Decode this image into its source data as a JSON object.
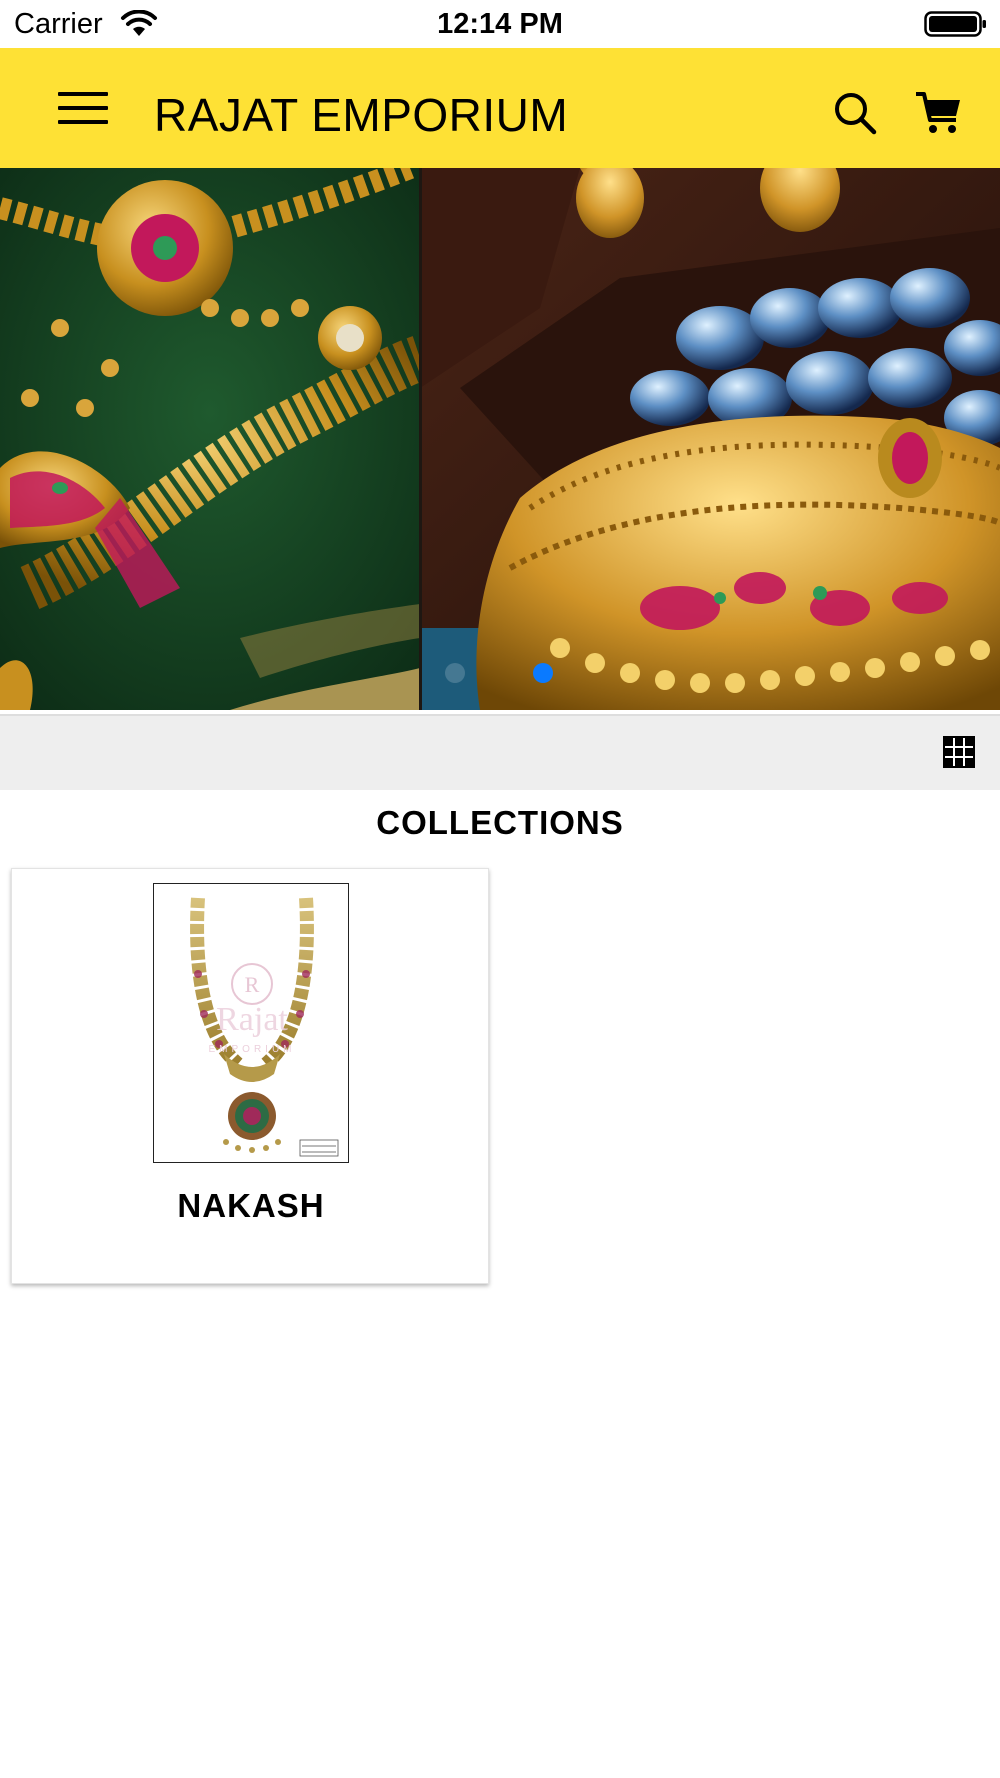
{
  "status_bar": {
    "carrier": "Carrier",
    "time": "12:14 PM",
    "wifi_icon": "wifi-icon",
    "battery_icon": "battery-full-icon"
  },
  "app_bar": {
    "title": "RAJAT EMPORIUM",
    "background_color": "#fee135",
    "menu_icon": "hamburger-menu-icon",
    "search_icon": "search-icon",
    "cart_icon": "shopping-cart-icon"
  },
  "banner": {
    "slide_count": 2,
    "active_slide": 2,
    "indicator_active_color": "#0a7aff"
  },
  "toolbar": {
    "view_toggle_icon": "grid-view-icon"
  },
  "collections": {
    "heading": "COLLECTIONS",
    "items": [
      {
        "label": "NAKASH",
        "thumbnail_watermark": {
          "monogram": "R",
          "brand": "Rajat",
          "sub": "EMPORIUM"
        }
      }
    ]
  }
}
